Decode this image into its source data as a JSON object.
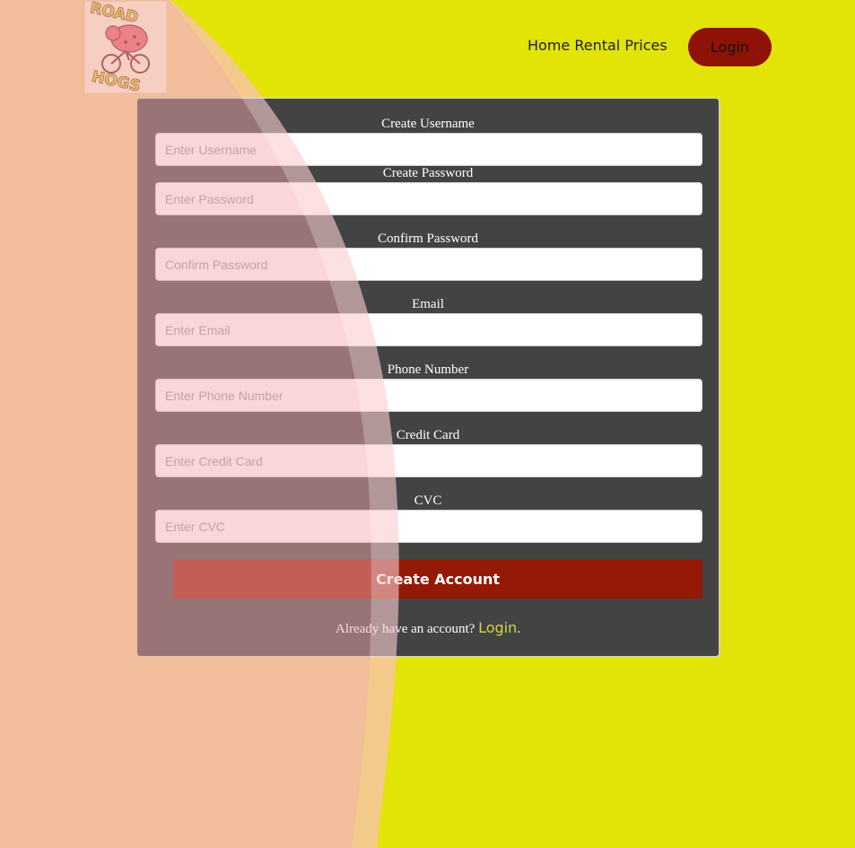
{
  "nav": {
    "logo_alt": "ROAD HOGS",
    "home_rental_prices": "Home Rental Prices",
    "login": "Login"
  },
  "form": {
    "username": {
      "label": "Create Username",
      "placeholder": "Enter Username"
    },
    "password": {
      "label": "Create Password",
      "placeholder": "Enter Password"
    },
    "confirm": {
      "label": "Confirm Password",
      "placeholder": "Confirm Password"
    },
    "email": {
      "label": "Email",
      "placeholder": "Enter Email"
    },
    "phone": {
      "label": "Phone Number",
      "placeholder": "Enter Phone Number"
    },
    "credit": {
      "label": "Credit Card",
      "placeholder": "Enter Credit Card"
    },
    "cvc": {
      "label": "CVC",
      "placeholder": "Enter CVC"
    },
    "submit": "Create Account",
    "login_prompt": "Already have an account?",
    "login_link": "Login",
    "login_suffix": "."
  },
  "colors": {
    "background": "#e2e407",
    "card": "#434343",
    "accent": "#941a07",
    "link": "#d8d340"
  }
}
